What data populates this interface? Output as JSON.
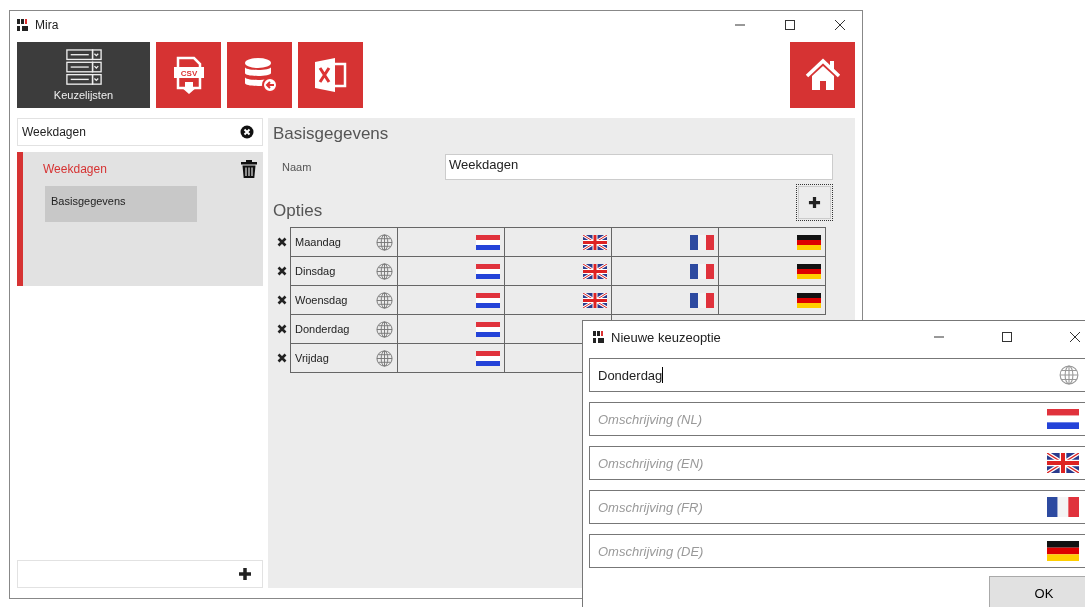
{
  "window": {
    "title": "Mira"
  },
  "toolbar": [
    {
      "kind": "lists",
      "label": "Keuzelijsten",
      "selected": true
    },
    {
      "kind": "csv",
      "label": "CSV",
      "selected": false
    },
    {
      "kind": "database",
      "selected": false
    },
    {
      "kind": "excel",
      "selected": false
    }
  ],
  "search": {
    "value": "Weekdagen"
  },
  "lists": [
    {
      "label": "Weekdagen",
      "selected": true,
      "children": [
        {
          "label": "Basisgegevens",
          "selected": true
        }
      ]
    }
  ],
  "details": {
    "section_title": "Basisgegevens",
    "name_label": "Naam",
    "name_value": "Weekdagen",
    "options_title": "Opties",
    "options": [
      {
        "name": "Maandag",
        "cells": [
          {
            "kind": "nl"
          },
          {
            "kind": "en"
          },
          {
            "kind": "fr"
          },
          {
            "kind": "de"
          }
        ]
      },
      {
        "name": "Dinsdag",
        "cells": [
          {
            "kind": "nl"
          },
          {
            "kind": "en"
          },
          {
            "kind": "fr"
          },
          {
            "kind": "de"
          }
        ]
      },
      {
        "name": "Woensdag",
        "cells": [
          {
            "kind": "nl"
          },
          {
            "kind": "en"
          },
          {
            "kind": "fr"
          },
          {
            "kind": "de"
          }
        ]
      },
      {
        "name": "Donderdag",
        "cells": [
          {
            "kind": "nl"
          },
          {
            "kind": "blank"
          }
        ]
      },
      {
        "name": "Vrijdag",
        "cells": [
          {
            "kind": "nl"
          },
          {
            "kind": "blank"
          }
        ]
      }
    ]
  },
  "dialog": {
    "title": "Nieuwe keuzeoptie",
    "name_value": "Donderdag",
    "fields": [
      {
        "placeholder": "Omschrijving (NL)",
        "kind": "nl"
      },
      {
        "placeholder": "Omschrijving (EN)",
        "kind": "en"
      },
      {
        "placeholder": "Omschrijving (FR)",
        "kind": "fr"
      },
      {
        "placeholder": "Omschrijving (DE)",
        "kind": "de"
      }
    ],
    "ok": "OK"
  }
}
